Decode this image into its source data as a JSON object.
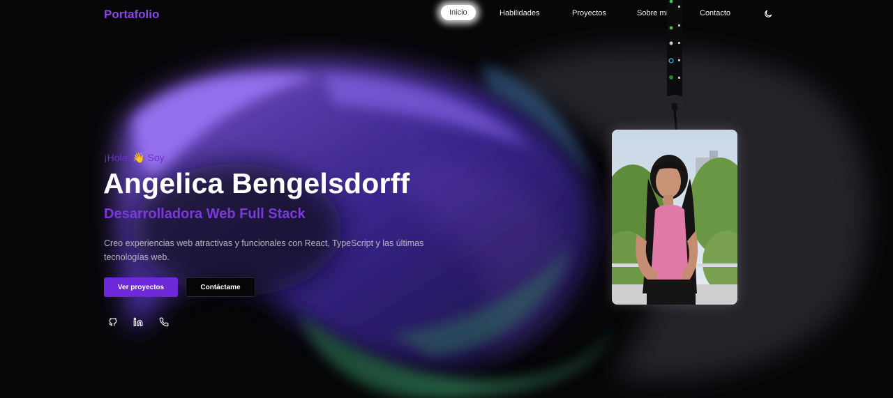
{
  "nav": {
    "logo": "Portafolio",
    "items": [
      {
        "label": "Inicio",
        "active": true
      },
      {
        "label": "Habilidades",
        "active": false
      },
      {
        "label": "Proyectos",
        "active": false
      },
      {
        "label": "Sobre mí",
        "active": false
      },
      {
        "label": "Contacto",
        "active": false
      }
    ],
    "theme_icon": "moon-icon"
  },
  "hero": {
    "greeting": "¡Hola! 👋 Soy",
    "name": "Angelica Bengelsdorff",
    "role": "Desarrolladora Web Full Stack",
    "description": "Creo experiencias web atractivas y funcionales con React, TypeScript y las últimas tecnologías web.",
    "primary_button": "Ver proyectos",
    "secondary_button": "Contáctame",
    "social_icons": [
      "github-icon",
      "linkedin-icon",
      "phone-icon"
    ]
  },
  "badge": {
    "photo_icon": "profile-photo",
    "lanyard_icons": [
      "node-icon",
      "mongodb-icon",
      "react-icon",
      "database-icon"
    ]
  },
  "colors": {
    "accent": "#7b38de",
    "button": "#6d28d9",
    "background": "#070608"
  }
}
